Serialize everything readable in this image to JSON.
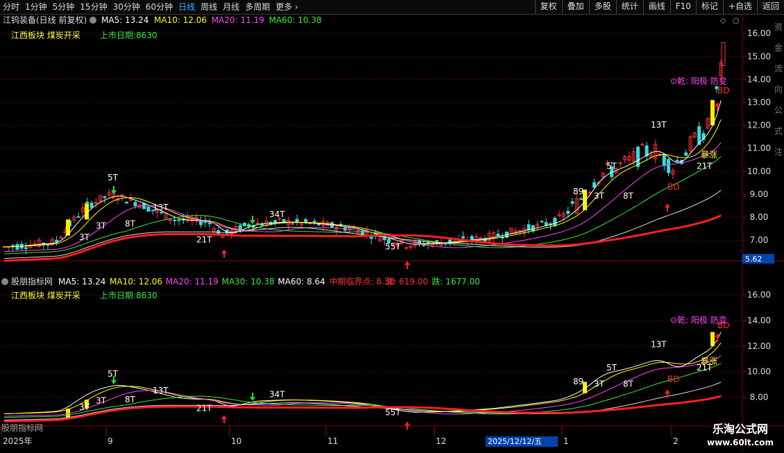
{
  "toolbar": {
    "period_tabs": [
      "分时",
      "1分钟",
      "5分钟",
      "15分钟",
      "30分钟",
      "60分钟",
      "日线",
      "周线",
      "月线",
      "多周期",
      "更多"
    ],
    "active_tab": "日线",
    "tool_buttons": [
      "复权",
      "叠加",
      "多股",
      "统计",
      "画线",
      "F10",
      "标记",
      "+自选",
      "返回"
    ]
  },
  "main_panel": {
    "title": "江钨装备(日线 前复权)",
    "ma_labels": [
      {
        "text": "MA5: 13.24",
        "color": "#ffffff"
      },
      {
        "text": "MA10: 12.06",
        "color": "#ffff00"
      },
      {
        "text": "MA20: 11.19",
        "color": "#ff44ff"
      },
      {
        "text": "MA60: 10.38",
        "color": "#33ee33"
      }
    ],
    "info_left": "江西板块  煤炭开采",
    "info_right": "上市日期:8630",
    "price_ticks": [
      "16.00",
      "15.00",
      "14.00",
      "13.00",
      "12.00",
      "11.00",
      "10.00",
      "9.00",
      "8.00",
      "7.00"
    ],
    "current_price": "5.62"
  },
  "sub_panel": {
    "title": "股朋指标网",
    "labels": [
      {
        "text": "MA5: 13.24",
        "color": "#ffffff"
      },
      {
        "text": "MA10: 12.06",
        "color": "#ffff00"
      },
      {
        "text": "MA20: 11.19",
        "color": "#ff44ff"
      },
      {
        "text": "MA30: 10.38",
        "color": "#33ee33"
      },
      {
        "text": "MA60: 8.64",
        "color": "#ffffff"
      },
      {
        "text": "中期临界点: 8.30",
        "color": "#ff3333"
      },
      {
        "text": "涨: 619.00",
        "color": "#ff3333"
      },
      {
        "text": "跌: 1677.00",
        "color": "#33ee33"
      }
    ],
    "info_left": "江西板块  煤炭开采",
    "info_right": "上市日期:8630",
    "price_ticks": [
      "16.00",
      "14.00",
      "12.00",
      "10.00",
      "8.00"
    ]
  },
  "annotations": {
    "signal": "⊙乾: 阳极 防变",
    "bd": "BD",
    "surge": "暴涨",
    "t_5": "5T",
    "t_3": "3T",
    "t_8": "8T",
    "t_13": "13T",
    "t_21": "21T",
    "t_34": "34T",
    "t_55": "55T",
    "t_89": "89"
  },
  "time_axis": {
    "labels": [
      "2025年",
      "9",
      "10",
      "11",
      "12",
      "1",
      "2"
    ],
    "cursor_date": "2025/12/12/五",
    "bottom_left_text": "股朋指标网"
  },
  "side_text": "资金流向公式注",
  "watermark": {
    "line1": "乐淘公式网",
    "line2": "www.60lt.com"
  },
  "colors": {
    "background": "#000000",
    "up": "#ff3333",
    "down": "#33dddd",
    "ma5": "#ffffff",
    "ma10": "#ffff00",
    "ma20": "#ff44ff",
    "ma60": "#33ee33",
    "critical": "#ff2020",
    "grid": "#6a0000"
  }
}
